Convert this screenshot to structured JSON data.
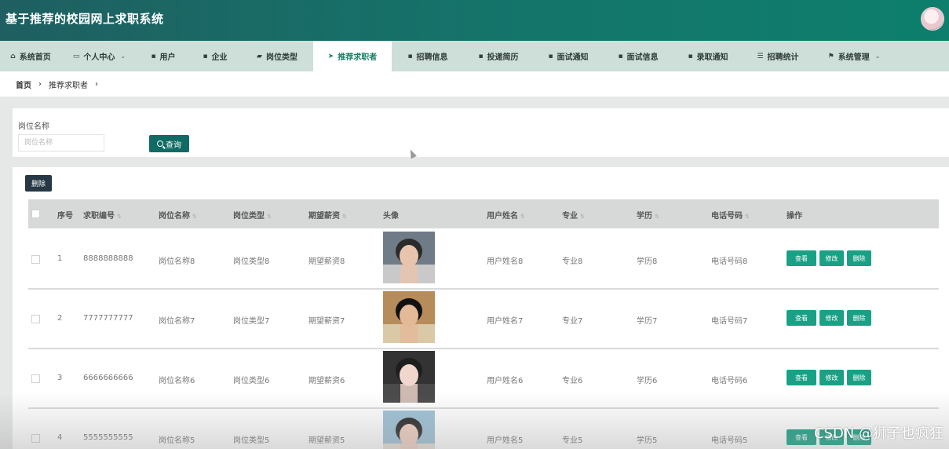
{
  "header": {
    "title": "基于推荐的校园网上求职系统"
  },
  "nav": [
    {
      "label": "系统首页",
      "icon": "home-icon",
      "glyph": "⌂",
      "chevron": false,
      "active": false,
      "width": 78
    },
    {
      "label": "个人中心",
      "icon": "card-icon",
      "glyph": "▭",
      "chevron": true,
      "active": false,
      "width": 97
    },
    {
      "label": "用户",
      "icon": "grid-icon",
      "glyph": "▪",
      "chevron": false,
      "active": false,
      "width": 66
    },
    {
      "label": "企业",
      "icon": "grid-icon",
      "glyph": "▪",
      "chevron": false,
      "active": false,
      "width": 66
    },
    {
      "label": "岗位类型",
      "icon": "briefcase-icon",
      "glyph": "▰",
      "chevron": false,
      "active": false,
      "width": 92
    },
    {
      "label": "推荐求职者",
      "icon": "send-icon",
      "glyph": "➤",
      "chevron": false,
      "active": true,
      "width": 100
    },
    {
      "label": "招聘信息",
      "icon": "grid-icon",
      "glyph": "▪",
      "chevron": false,
      "active": false,
      "width": 92
    },
    {
      "label": "投递简历",
      "icon": "grid-icon",
      "glyph": "▪",
      "chevron": false,
      "active": false,
      "width": 88
    },
    {
      "label": "面试通知",
      "icon": "grid-icon",
      "glyph": "▪",
      "chevron": false,
      "active": false,
      "width": 90
    },
    {
      "label": "面试信息",
      "icon": "grid-icon",
      "glyph": "▪",
      "chevron": false,
      "active": false,
      "width": 88
    },
    {
      "label": "录取通知",
      "icon": "grid-icon",
      "glyph": "▪",
      "chevron": false,
      "active": false,
      "width": 90
    },
    {
      "label": "招聘统计",
      "icon": "list-icon",
      "glyph": "☰",
      "chevron": false,
      "active": false,
      "width": 88
    },
    {
      "label": "系统管理",
      "icon": "flag-icon",
      "glyph": "⚑",
      "chevron": true,
      "active": false,
      "width": 106
    }
  ],
  "breadcrumb": {
    "home": "首页",
    "current": "推荐求职者",
    "sep": "›"
  },
  "search": {
    "label": "岗位名称",
    "placeholder": "岗位名称",
    "button": "查询"
  },
  "table": {
    "delete_batch": "删除",
    "headers": {
      "index": "序号",
      "job_no": "求职编号",
      "position": "岗位名称",
      "type": "岗位类型",
      "salary": "期望薪资",
      "photo": "头像",
      "name": "用户姓名",
      "major": "专业",
      "education": "学历",
      "phone": "电话号码",
      "actions": "操作"
    },
    "sort_glyph": "⇅",
    "action_labels": {
      "view": "查看",
      "edit": "修改",
      "delete": "删除"
    },
    "rows": [
      {
        "index": "1",
        "job_no": "8888888888",
        "position": "岗位名称8",
        "type": "岗位类型8",
        "salary": "期望薪资8",
        "name": "用户姓名8",
        "major": "专业8",
        "education": "学历8",
        "phone": "电话号码8",
        "photo_colors": [
          "#6f7b86",
          "#e9c4ad",
          "#2b2b2b",
          "#c9c9c9"
        ]
      },
      {
        "index": "2",
        "job_no": "7777777777",
        "position": "岗位名称7",
        "type": "岗位类型7",
        "salary": "期望薪资7",
        "name": "用户姓名7",
        "major": "专业7",
        "education": "学历7",
        "phone": "电话号码7",
        "photo_colors": [
          "#b58c5a",
          "#e4b998",
          "#111111",
          "#d9c9a6"
        ]
      },
      {
        "index": "3",
        "job_no": "6666666666",
        "position": "岗位名称6",
        "type": "岗位类型6",
        "salary": "期望薪资6",
        "name": "用户姓名6",
        "major": "专业6",
        "education": "学历6",
        "phone": "电话号码6",
        "photo_colors": [
          "#333333",
          "#f0d6cc",
          "#1e1e1e",
          "#4a4a4a"
        ]
      },
      {
        "index": "4",
        "job_no": "5555555555",
        "position": "岗位名称5",
        "type": "岗位类型5",
        "salary": "期望薪资5",
        "name": "用户姓名5",
        "major": "专业5",
        "education": "学历5",
        "phone": "电话号码5",
        "photo_colors": [
          "#9ec2d6",
          "#f1d0c2",
          "#2a2a2a",
          "#e7e0d6"
        ]
      }
    ]
  },
  "watermark": "CSDN @狮子也疯狂",
  "colors": {
    "primary": "#1aa185",
    "header_dark": "#1f5f61",
    "search_button": "#0f6b63",
    "batch_delete": "#263746",
    "nav_bg": "#cddfd8"
  }
}
